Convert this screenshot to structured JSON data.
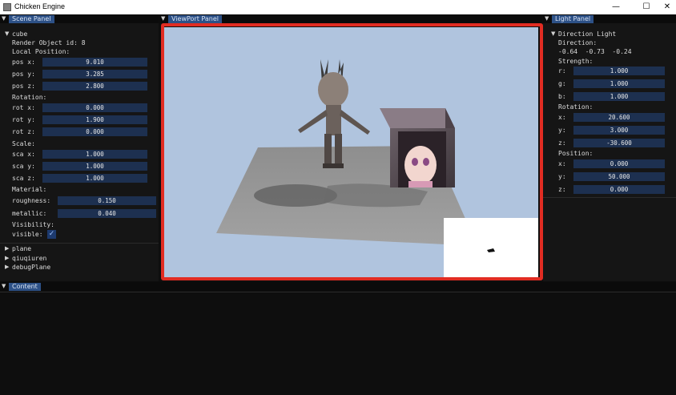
{
  "window": {
    "title": "Chicken Engine",
    "minimize_icon": "minimize-icon",
    "maximize_icon": "maximize-icon",
    "close_icon": "close-icon"
  },
  "scene_panel": {
    "tab_label": "Scene Panel",
    "object_name": "cube",
    "render_object_id": "Render Object id: 8",
    "local_position_label": "Local Position:",
    "pos_x_label": "pos x:",
    "pos_x": "9.010",
    "pos_y_label": "pos y:",
    "pos_y": "3.285",
    "pos_z_label": "pos z:",
    "pos_z": "2.800",
    "rotation_label": "Rotation:",
    "rot_x_label": "rot x:",
    "rot_x": "0.000",
    "rot_y_label": "rot y:",
    "rot_y": "1.900",
    "rot_z_label": "rot z:",
    "rot_z": "0.000",
    "scale_label": "Scale:",
    "sca_x_label": "sca x:",
    "sca_x": "1.000",
    "sca_y_label": "sca y:",
    "sca_y": "1.000",
    "sca_z_label": "sca z:",
    "sca_z": "1.000",
    "material_label": "Material:",
    "roughness_label": "roughness:",
    "roughness": "0.150",
    "metallic_label": "metallic:",
    "metallic": "0.040",
    "visibility_label": "Visibility:",
    "visible_label": "visible:",
    "visible_check": "✓",
    "other_objects": [
      "plane",
      "qiuqiuren",
      "debugPlane"
    ]
  },
  "viewport_panel": {
    "tab_label": "ViewPort Panel"
  },
  "light_panel": {
    "tab_label": "Light Panel",
    "section": "Direction Light",
    "direction_label": "Direction:",
    "direction_values": "-0.64  -0.73  -0.24",
    "strength_label": "Strength:",
    "r_label": "r:",
    "r": "1.000",
    "g_label": "g:",
    "g": "1.000",
    "b_label": "b:",
    "b": "1.000",
    "rotation_label": "Rotation:",
    "rx_label": "x:",
    "rx": "20.600",
    "ry_label": "y:",
    "ry": "3.000",
    "rz_label": "z:",
    "rz": "-30.600",
    "position_label": "Position:",
    "px_label": "x:",
    "px": "0.000",
    "py_label": "y:",
    "py": "50.000",
    "pz_label": "z:",
    "pz": "0.000"
  },
  "content_panel": {
    "tab_label": "Content"
  },
  "colors": {
    "accent": "#2d5187",
    "field": "#1d3050",
    "highlight": "#e12c22",
    "sky": "#b0c4de"
  }
}
